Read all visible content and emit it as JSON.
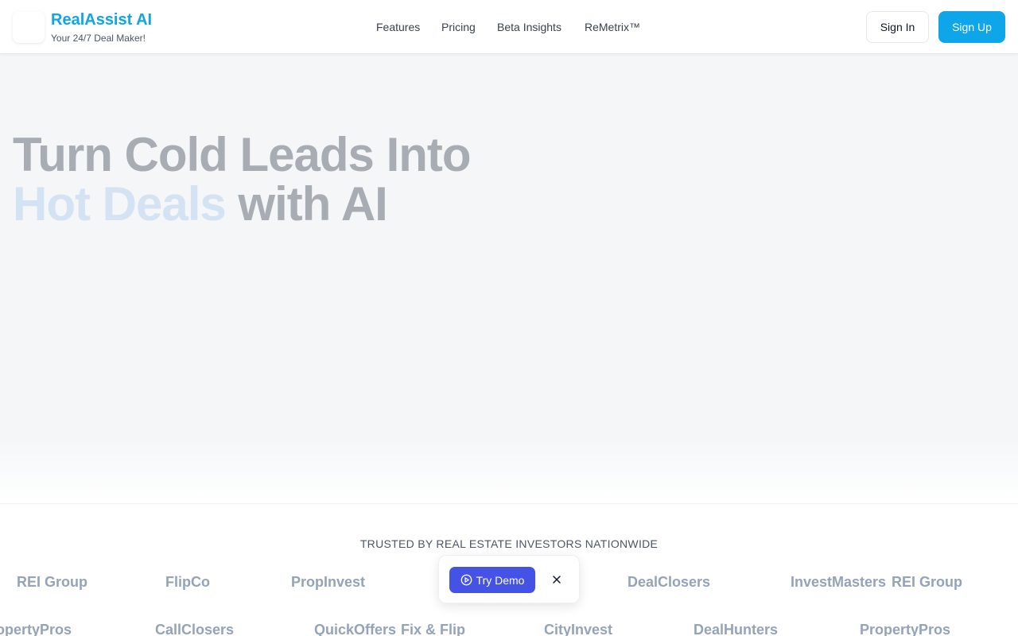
{
  "brand": {
    "name": "RealAssist AI",
    "tagline": "Your 24/7 Deal Maker!",
    "accent_color": "#0ea5e9"
  },
  "nav": {
    "links": [
      "Features",
      "Pricing",
      "Beta Insights",
      "ReMetrix™"
    ]
  },
  "auth": {
    "signin_label": "Sign In",
    "signup_label": "Sign Up"
  },
  "hero": {
    "title_line1": "Turn Cold Leads Into",
    "title_highlight": "Hot Deals",
    "title_rest": " with AI"
  },
  "trusted": {
    "heading": "TRUSTED BY REAL ESTATE INVESTORS NATIONWIDE",
    "row1": [
      "REI Group",
      "FlipCo",
      "PropInvest",
      "DealClosers",
      "InvestMasters",
      "REI Group"
    ],
    "row2": [
      "PropertyPros",
      "CallClosers",
      "QuickOffers",
      "Fix & Flip",
      "CityInvest",
      "DealHunters",
      "PropertyPros"
    ]
  },
  "demo_popup": {
    "button_label": "Try Demo",
    "button_color": "#4452e6",
    "icons": [
      "play-circle-icon",
      "close-icon"
    ]
  }
}
